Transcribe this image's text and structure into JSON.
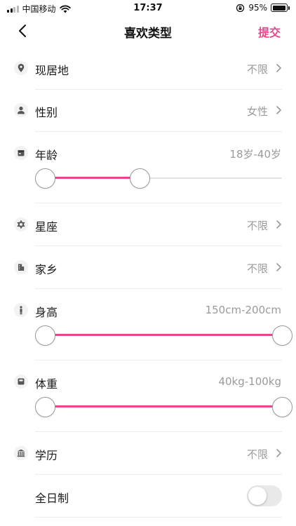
{
  "status_bar": {
    "carrier": "中国移动",
    "time": "17:37",
    "battery": "95%"
  },
  "nav": {
    "title": "喜欢类型",
    "submit_label": "提交"
  },
  "rows": {
    "residence": {
      "label": "现居地",
      "value": "不限",
      "icon": "location-pin-icon"
    },
    "gender": {
      "label": "性别",
      "value": "女性",
      "icon": "person-icon"
    },
    "age": {
      "label": "年龄",
      "value": "18岁-40岁",
      "icon": "calendar-icon",
      "range": {
        "min_fraction": 0.0,
        "max_fraction": 0.4
      }
    },
    "zodiac": {
      "label": "星座",
      "value": "不限",
      "icon": "star-of-david-icon"
    },
    "hometown": {
      "label": "家乡",
      "value": "不限",
      "icon": "building-icon"
    },
    "height": {
      "label": "身高",
      "value": "150cm-200cm",
      "icon": "standing-person-icon",
      "range": {
        "min_fraction": 0.0,
        "max_fraction": 1.0
      }
    },
    "weight": {
      "label": "体重",
      "value": "40kg-100kg",
      "icon": "scale-icon",
      "range": {
        "min_fraction": 0.0,
        "max_fraction": 1.0
      }
    },
    "education": {
      "label": "学历",
      "value": "不限",
      "icon": "institution-icon"
    },
    "fulltime": {
      "label": "全日制",
      "enabled": false
    }
  },
  "colors": {
    "accent": "#e8458c",
    "value_gray": "#9a9a9a"
  }
}
